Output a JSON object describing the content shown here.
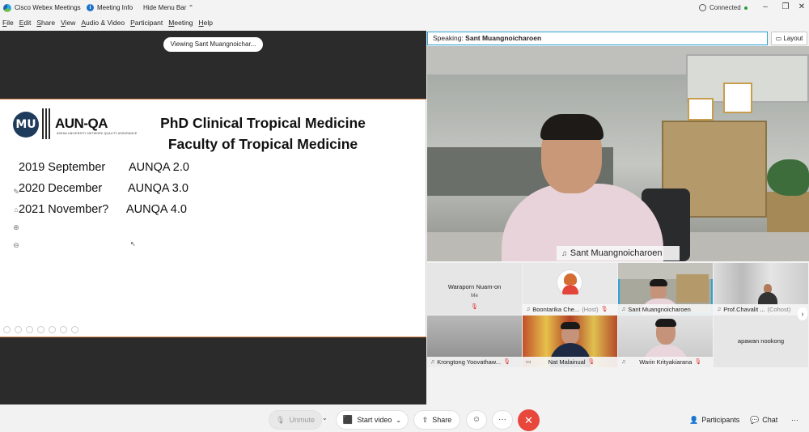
{
  "titlebar": {
    "app_name": "Cisco Webex Meetings",
    "meeting_info": "Meeting Info",
    "hide_menu": "Hide Menu Bar ⌃",
    "connected": "Connected",
    "minimize": "–",
    "restore": "❐",
    "close": "✕"
  },
  "menu": {
    "items": [
      {
        "u": "F",
        "rest": "ile"
      },
      {
        "u": "E",
        "rest": "dit"
      },
      {
        "u": "S",
        "rest": "hare"
      },
      {
        "u": "V",
        "rest": "iew"
      },
      {
        "u": "A",
        "rest": "udio & Video"
      },
      {
        "u": "P",
        "rest": "articipant"
      },
      {
        "u": "M",
        "rest": "eeting"
      },
      {
        "u": "H",
        "rest": "elp"
      }
    ]
  },
  "share": {
    "viewing_label": "Viewing Sant Muangnoichar...",
    "slide": {
      "mu_logo": "MU",
      "aun_logo": "AUN-QA",
      "aun_sub": "ASEAN UNIVERSITY NETWORK QUALITY ASSURANCE",
      "title_line1": "PhD Clinical Tropical Medicine",
      "title_line2": "Faculty of Tropical Medicine",
      "rows": [
        {
          "date": "2019 September",
          "version": "AUNQA 2.0"
        },
        {
          "date": "2020 December",
          "version": "AUNQA 3.0"
        },
        {
          "date": "2021 November?",
          "version": "AUNQA 4.0"
        }
      ]
    }
  },
  "speaking": {
    "prefix": "Speaking: ",
    "name": "Sant Muangnoicharoen",
    "layout_label": "Layout"
  },
  "main_video": {
    "speaker_name": "Sant Muangnoicharoen"
  },
  "participants": [
    {
      "name": "Waraporn Nuam-on",
      "sub": "Me"
    },
    {
      "name": "Boontarika Che...",
      "role": "(Host)"
    },
    {
      "name": "Sant Muangnoicharoen"
    },
    {
      "name": "Prof.Chavalit ...",
      "role": "(Cohost)"
    },
    {
      "name": "Krongtong Yoovathaw..."
    },
    {
      "name": "Nat Malainual"
    },
    {
      "name": "Warin Krityakiarana"
    },
    {
      "name": "apawan nookong"
    }
  ],
  "controls": {
    "unmute": "Unmute",
    "start_video": "Start video",
    "share": "Share",
    "participants": "Participants",
    "chat": "Chat"
  },
  "colors": {
    "accent": "#2ea3d6",
    "end_call": "#e8473b",
    "muted": "#d33333"
  }
}
